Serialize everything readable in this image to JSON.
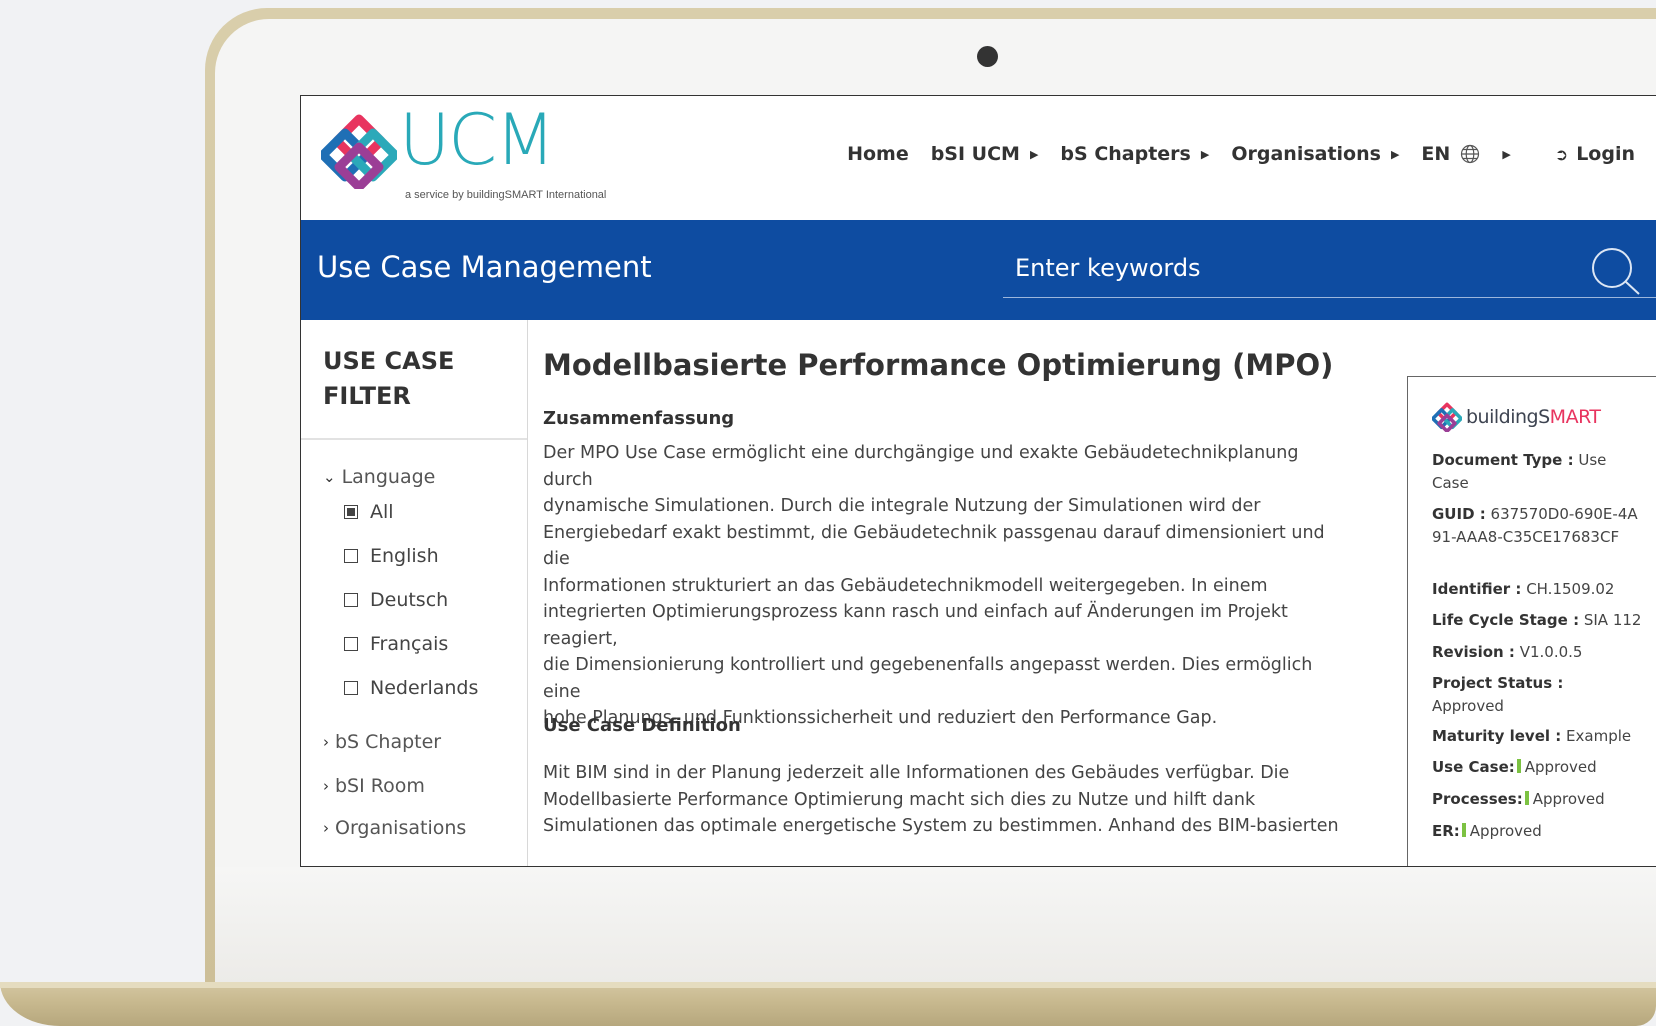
{
  "header": {
    "logo_text": "UCM",
    "logo_tagline": "a service by buildingSMART International",
    "nav": [
      {
        "label": "Home"
      },
      {
        "label": "bSI UCM"
      },
      {
        "label": "bS Chapters"
      },
      {
        "label": "Organisations"
      },
      {
        "label": "EN"
      },
      {
        "label": "Login"
      }
    ]
  },
  "band": {
    "title": "Use Case Management",
    "search_placeholder": "Enter keywords"
  },
  "sidebar": {
    "title": "USE CASE FILTER",
    "language_label": "Language",
    "options": [
      {
        "label": "All",
        "checked": true
      },
      {
        "label": "English",
        "checked": false
      },
      {
        "label": "Deutsch",
        "checked": false
      },
      {
        "label": "Français",
        "checked": false
      },
      {
        "label": "Nederlands",
        "checked": false
      }
    ],
    "facets": [
      "bS Chapter",
      "bSI Room",
      "Organisations"
    ]
  },
  "main": {
    "title": "Modellbasierte Performance Optimierung (MPO)",
    "summary_heading": "Zusammenfassung",
    "summary_lines": [
      "Der MPO Use Case ermöglicht eine durchgängige und exakte Gebäudetechnikplanung durch",
      "dynamische Simulationen. Durch die integrale Nutzung der Simulationen wird der",
      "Energiebedarf exakt bestimmt, die Gebäudetechnik passgenau darauf dimensioniert und die",
      "Informationen strukturiert an das Gebäudetechnikmodell weitergegeben. In einem",
      "integrierten Optimierungsprozess kann rasch und einfach auf Änderungen im Projekt reagiert,",
      "die Dimensionierung kontrolliert und gegebenenfalls angepasst werden. Dies ermöglich eine",
      "hohe Planungs- und Funktionssicherheit und reduziert den Performance Gap."
    ],
    "definition_heading": "Use Case Definition",
    "definition_lines": [
      "Mit BIM sind in der Planung jederzeit alle Informationen des Gebäudes verfügbar. Die",
      "Modellbasierte Performance Optimierung macht sich dies zu Nutze und hilft dank",
      "Simulationen das optimale energetische System zu bestimmen. Anhand des BIM-basierten"
    ]
  },
  "info": {
    "logo_prefix": "buildingS",
    "logo_suffix": "MART",
    "rows": [
      {
        "key": "Document Type :",
        "value": "Use Case"
      },
      {
        "key": "GUID :",
        "value": "637570D0-690E-4A91-AAA8-C35CE17683CF"
      },
      {
        "key": "Identifier :",
        "value": "CH.1509.02"
      },
      {
        "key": "Life Cycle Stage :",
        "value": "SIA 112"
      },
      {
        "key": "Revision :",
        "value": "V1.0.0.5"
      },
      {
        "key": "Project Status :",
        "value": "Approved"
      },
      {
        "key": "Maturity level :",
        "value": "Example"
      },
      {
        "key": "Use Case:",
        "value": "Approved"
      },
      {
        "key": "Processes:",
        "value": "Approved"
      },
      {
        "key": "ER:",
        "value": "Approved"
      }
    ]
  },
  "colors": {
    "brand_blue": "#0e4ca1",
    "logo_teal": "#29a9b8",
    "status_green": "#7cc242"
  }
}
